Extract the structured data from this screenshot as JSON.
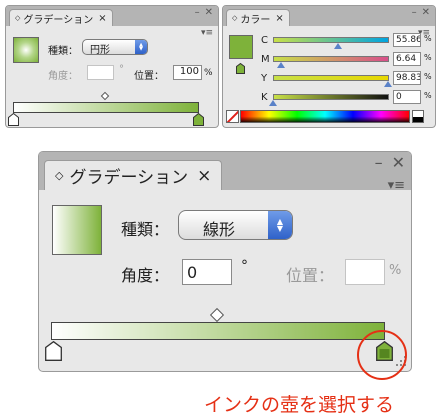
{
  "small_gradient_panel": {
    "tab_title": "グラデーション",
    "close_glyph": "×",
    "type_label": "種類：",
    "type_value": "円形",
    "angle_label": "角度：",
    "angle_value": "",
    "angle_unit": "°",
    "location_label": "位置：",
    "location_value": "100",
    "location_unit": "%"
  },
  "color_panel": {
    "tab_title": "カラー",
    "close_glyph": "×",
    "channels": [
      {
        "name": "C",
        "value": "55.86",
        "unit": "%",
        "level": 0.5586,
        "color": "#00a4e0"
      },
      {
        "name": "M",
        "value": "6.64",
        "unit": "%",
        "level": 0.0664,
        "color": "#d84f8a"
      },
      {
        "name": "Y",
        "value": "98.83",
        "unit": "%",
        "level": 0.9883,
        "color": "#e8d800"
      },
      {
        "name": "K",
        "value": "0",
        "unit": "%",
        "level": 0.0,
        "color": "#111111"
      }
    ]
  },
  "large_gradient_panel": {
    "tab_title": "グラデーション",
    "close_glyph": "×",
    "type_label": "種類：",
    "type_value": "線形",
    "angle_label": "角度：",
    "angle_value": "0",
    "angle_unit": "°",
    "location_label": "位置：",
    "location_value": "",
    "location_unit": "%"
  },
  "window_glyphs": {
    "minimize": "–",
    "close": "✕",
    "menu": "▾≡"
  },
  "gradient": {
    "start_color": "#ffffff",
    "end_color": "#7eb23a",
    "selected_stop": 1
  },
  "callout": {
    "text": "インクの壺を選択する",
    "color": "#e53015"
  }
}
